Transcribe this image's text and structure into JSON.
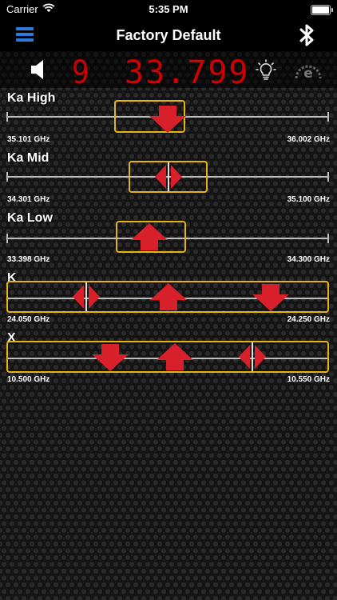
{
  "status_bar": {
    "carrier": "Carrier",
    "time": "5:35 PM"
  },
  "nav": {
    "title": "Factory Default",
    "menu_icon": "hamburger-menu-icon",
    "bluetooth_icon": "bluetooth-icon"
  },
  "display": {
    "band_digit": "9",
    "frequency": "33.799",
    "speaker_icon": "speaker-icon",
    "brightness_icon": "lightbulb-icon",
    "eco_icon": "eco-gauge-icon"
  },
  "colors": {
    "accent_blue": "#2a7bdc",
    "digit_red": "#d00000",
    "window_yellow": "#e5b411",
    "marker_red": "#d8202a"
  },
  "bands": [
    {
      "name": "Ka High",
      "min": "35.101 GHz",
      "max": "36.002 GHz",
      "markers": [
        "down-arrow"
      ]
    },
    {
      "name": "Ka Mid",
      "min": "34.301 GHz",
      "max": "35.100 GHz",
      "markers": [
        "split-marker"
      ]
    },
    {
      "name": "Ka Low",
      "min": "33.398 GHz",
      "max": "34.300 GHz",
      "markers": [
        "up-arrow"
      ]
    },
    {
      "name": "K",
      "min": "24.050 GHz",
      "max": "24.250 GHz",
      "markers": [
        "split-marker",
        "up-arrow",
        "down-arrow"
      ]
    },
    {
      "name": "X",
      "min": "10.500 GHz",
      "max": "10.550 GHz",
      "markers": [
        "down-arrow",
        "up-arrow",
        "split-marker"
      ]
    }
  ]
}
